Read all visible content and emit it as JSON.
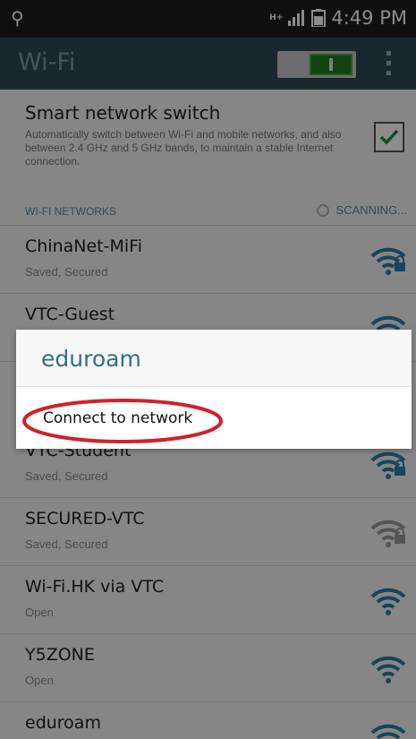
{
  "status_bar": {
    "usb_icon": "usb-icon",
    "network_type": "H+",
    "signal_icon": "signal-icon",
    "battery_icon": "battery-icon",
    "time": "4:49 PM"
  },
  "action_bar": {
    "title": "Wi-Fi",
    "toggle_state": "on",
    "menu_icon": "overflow-menu-icon"
  },
  "smart_switch": {
    "title": "Smart network switch",
    "description": "Automatically switch between Wi-Fi and mobile networks, and also between 2.4 GHz and 5 GHz bands, to maintain a stable Internet connection.",
    "checked": true
  },
  "networks_section": {
    "header": "WI-FI NETWORKS",
    "status": "SCANNING..."
  },
  "networks": [
    {
      "name": "ChinaNet-MiFi",
      "status": "Saved, Secured",
      "icon": "wifi-lock-icon",
      "color": "#2a7fa3"
    },
    {
      "name": "VTC-Guest",
      "status": "",
      "icon": "wifi-icon",
      "color": "#2a7fa3"
    },
    {
      "name": "VTC-Student",
      "status": "Saved, Secured",
      "icon": "wifi-lock-icon",
      "color": "#2a7fa3"
    },
    {
      "name": "SECURED-VTC",
      "status": "Saved, Secured",
      "icon": "wifi-lock-icon",
      "color": "#9a9a9a"
    },
    {
      "name": "Wi-Fi.HK via VTC",
      "status": "Open",
      "icon": "wifi-icon",
      "color": "#2a7fa3"
    },
    {
      "name": "Y5ZONE",
      "status": "Open",
      "icon": "wifi-icon",
      "color": "#2a7fa3"
    },
    {
      "name": "eduroam",
      "status": "",
      "icon": "wifi-icon",
      "color": "#2a7fa3"
    }
  ],
  "dialog": {
    "title": "eduroam",
    "option": "Connect to network",
    "annotation_color": "#d0222a"
  },
  "colors": {
    "action_bar": "#2d4a56",
    "accent": "#2e6f86",
    "toggle_on": "#1e7a1e"
  }
}
